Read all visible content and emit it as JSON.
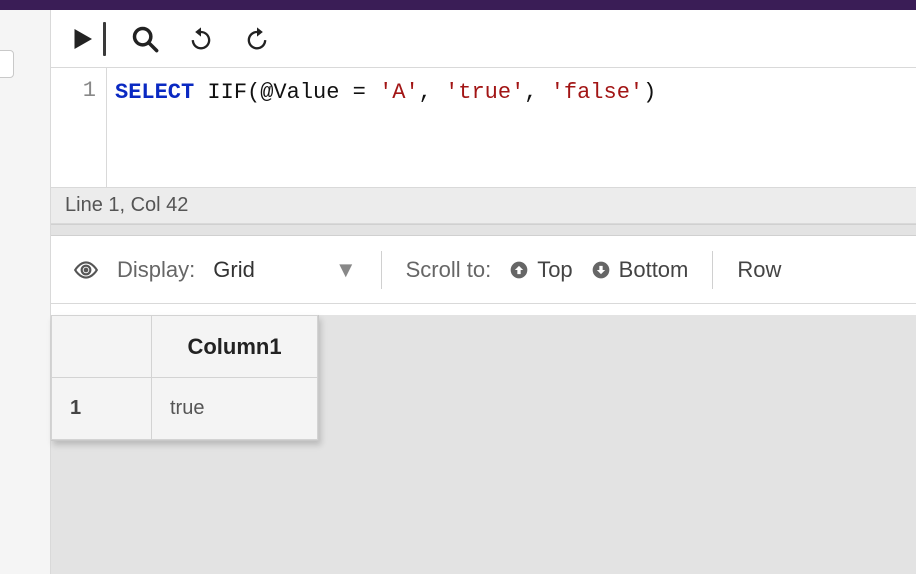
{
  "titlebar_color": "#3a1d56",
  "editor": {
    "line_number": "1",
    "tokens": {
      "keyword": "SELECT",
      "func": "IIF",
      "open": "(",
      "var": "@Value",
      "eq": " = ",
      "arg1": "'A'",
      "comma1": ", ",
      "arg2": "'true'",
      "comma2": ", ",
      "arg3": "'false'",
      "close": ")"
    }
  },
  "status": {
    "text": "Line 1, Col 42"
  },
  "results_toolbar": {
    "display_label": "Display:",
    "display_value": "Grid",
    "scroll_label": "Scroll to:",
    "top_label": "Top",
    "bottom_label": "Bottom",
    "row_label": "Row"
  },
  "grid": {
    "columns": [
      "Column1"
    ],
    "rows": [
      {
        "num": "1",
        "cells": [
          "true"
        ]
      }
    ]
  }
}
